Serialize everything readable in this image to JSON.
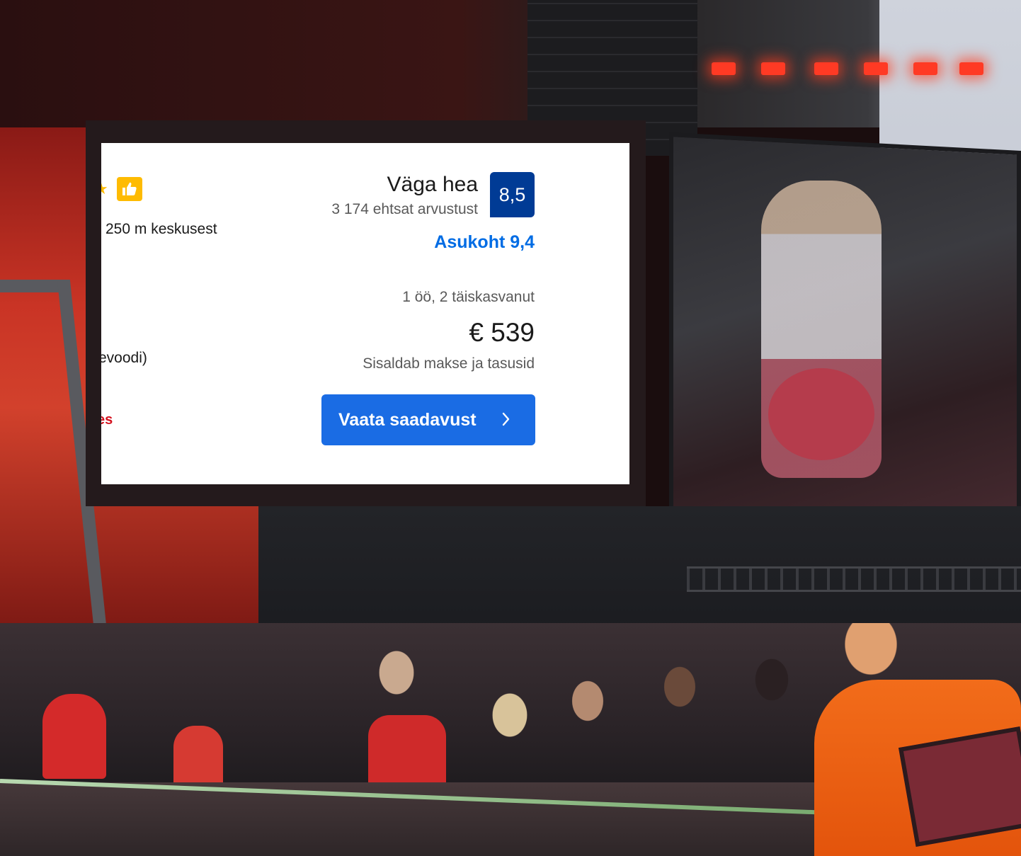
{
  "listing_card": {
    "rating_word": "Väga hea",
    "review_count": "3 174 ehtsat arvustust",
    "review_score": "8,5",
    "location_score": "Asukoht 9,4",
    "distance": "250 m keskusest",
    "bed_fragment": "evoodi)",
    "red_fragment": "es",
    "stay_info": "1 öö, 2 täiskasvanut",
    "price": "€ 539",
    "taxes_note": "Sisaldab makse ja tasusid",
    "cta_label": "Vaata saadavust"
  },
  "icons": {
    "star": "star-icon",
    "thumbs_up": "thumbs-up-icon",
    "chevron": "chevron-right-icon"
  },
  "colors": {
    "score_bg": "#003b95",
    "location_score": "#006ce4",
    "cta_bg": "#1a6ce4",
    "badge_yellow": "#febb02",
    "alert_red": "#d4111e"
  }
}
